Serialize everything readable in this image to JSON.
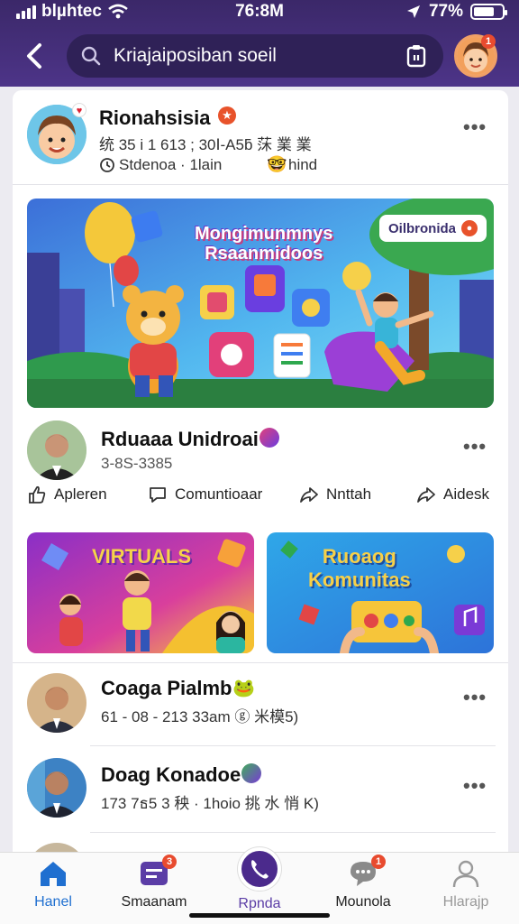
{
  "status_bar": {
    "carrier": "blµhtec",
    "time": "76:8M",
    "battery": "77%"
  },
  "search": {
    "placeholder": "Kriajaiposiban soeil"
  },
  "colors": {
    "header": "#3b2869",
    "accent": "#5b3da6",
    "badge": "#e84b2f",
    "active_nav": "#1f6fd0"
  },
  "header": {
    "avatar_badge": "1"
  },
  "post": {
    "author": "Rionahsisia",
    "subline": "统 35 i 1 613 ; 30Ⅰ-A5ƃ 莯 業 業",
    "status_label": "Stdenoa · 1lain",
    "tag_label": "hind",
    "banner": {
      "title_line1": "Mongimunmnys",
      "title_line2": "Rsaanmidoos",
      "tag": "Oilbronida"
    }
  },
  "second_post": {
    "author": "Rduaaa Unidroai",
    "subline": "3-8S-3385",
    "actions": [
      {
        "label": "Apleren",
        "icon": "like-icon"
      },
      {
        "label": "Comuntioaar",
        "icon": "comment-icon"
      },
      {
        "label": "Nnttah",
        "icon": "share-icon"
      },
      {
        "label": "Aidesk",
        "icon": "forward-icon"
      }
    ]
  },
  "tiles": [
    {
      "title": "VIRTUALS"
    },
    {
      "title_line1": "Ruoaog",
      "title_line2": "Komunitas"
    }
  ],
  "list": [
    {
      "name": "Coaga Pialmb",
      "meta": "61 - 08 - 213 33am ⓖ 米模5)"
    },
    {
      "name": "Doag Konadoe",
      "meta": "173 7ธ5 3 秧 · 1hoio 挑 水 悄 K)"
    }
  ],
  "nav": [
    {
      "label": "Hanel",
      "icon": "home-icon",
      "active": true
    },
    {
      "label": "Smaanam",
      "icon": "chat-icon",
      "badge": "3"
    },
    {
      "label": "Rpnda",
      "icon": "phone-icon"
    },
    {
      "label": "Mounola",
      "icon": "message-icon",
      "badge": "1"
    },
    {
      "label": "Hlarajp",
      "icon": "profile-icon"
    }
  ]
}
